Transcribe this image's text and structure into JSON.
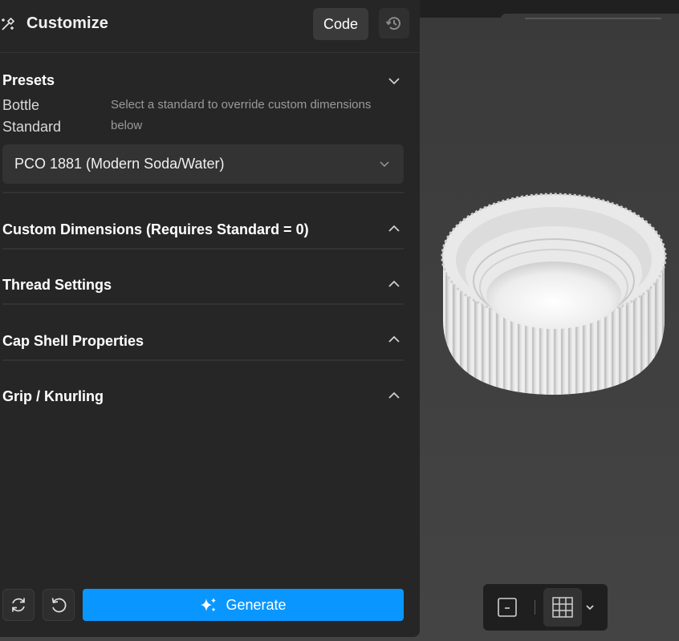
{
  "header": {
    "title": "Customize",
    "code_label": "Code"
  },
  "presets": {
    "title": "Presets",
    "field_label": "Bottle Standard",
    "help_text": "Select a standard to override custom dimensions below",
    "selected_value": "PCO 1881 (Modern Soda/Water)"
  },
  "sections": [
    {
      "label": "Custom Dimensions (Requires Standard = 0)"
    },
    {
      "label": "Thread Settings"
    },
    {
      "label": "Cap Shell Properties"
    },
    {
      "label": "Grip / Knurling"
    }
  ],
  "actions": {
    "generate_label": "Generate"
  },
  "icons": {
    "title": "magic-wand-icon",
    "history": "history-icon",
    "presets_toggle": "chevron-down-icon",
    "section_toggle": "chevron-up-icon",
    "reset": "refresh-icon",
    "undo": "undo-icon",
    "generate": "sparkles-icon",
    "view_ortho": "square-minus-icon",
    "view_grid": "grid-icon",
    "view_menu": "chevron-down-icon"
  },
  "colors": {
    "panel": "#262626",
    "accent": "#0a96ff",
    "viewport": "#3f3f3f"
  }
}
